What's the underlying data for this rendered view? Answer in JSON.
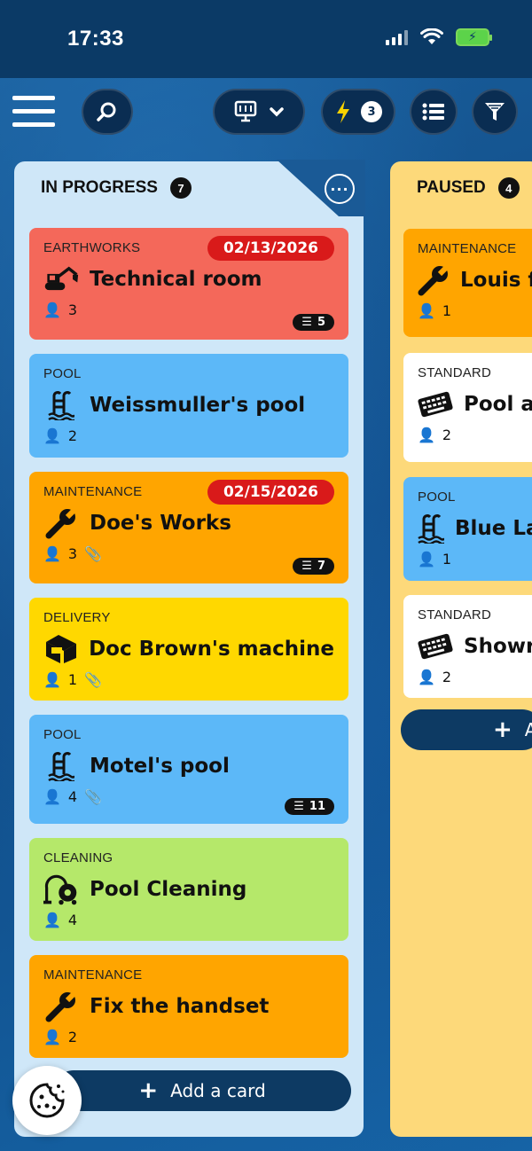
{
  "status_bar": {
    "time": "17:33"
  },
  "toolbar": {
    "quick_count": "3"
  },
  "columns": [
    {
      "title": "IN PROGRESS",
      "count": "7",
      "add_label": "Add a card",
      "cards": [
        {
          "type": "EARTHWORKS",
          "title": "Technical room",
          "members": "3",
          "date": "02/13/2026",
          "checklist": "5",
          "color": "#f4685a",
          "icon": "excavator-icon"
        },
        {
          "type": "POOL",
          "title": "Weissmuller's pool",
          "members": "2",
          "color": "#5cb8f8",
          "icon": "pool-ladder-icon"
        },
        {
          "type": "MAINTENANCE",
          "title": "Doe's Works",
          "members": "3",
          "date": "02/15/2026",
          "checklist": "7",
          "attachment": true,
          "color": "#ffa500",
          "icon": "wrench-icon"
        },
        {
          "type": "DELIVERY",
          "title": "Doc Brown's machine",
          "members": "1",
          "attachment": true,
          "color": "#ffd800",
          "icon": "delivery-box-icon"
        },
        {
          "type": "POOL",
          "title": "Motel's pool",
          "members": "4",
          "checklist": "11",
          "attachment": true,
          "color": "#5cb8f8",
          "icon": "pool-ladder-icon"
        },
        {
          "type": "CLEANING",
          "title": "Pool Cleaning",
          "members": "4",
          "color": "#b5e86a",
          "icon": "vacuum-icon"
        },
        {
          "type": "MAINTENANCE",
          "title": "Fix the handset",
          "members": "2",
          "color": "#ffa500",
          "icon": "wrench-icon"
        }
      ]
    },
    {
      "title": "PAUSED",
      "count": "4",
      "add_label": "A",
      "cards": [
        {
          "type": "MAINTENANCE",
          "title": "Louis f",
          "members": "1",
          "color": "#ffa500",
          "icon": "wrench-icon"
        },
        {
          "type": "STANDARD",
          "title": "Pool a",
          "members": "2",
          "color": "#ffffff",
          "icon": "keyboard-icon"
        },
        {
          "type": "POOL",
          "title": "Blue La",
          "members": "1",
          "color": "#5cb8f8",
          "icon": "pool-ladder-icon"
        },
        {
          "type": "STANDARD",
          "title": "Showr",
          "members": "2",
          "color": "#ffffff",
          "icon": "keyboard-icon"
        }
      ]
    }
  ]
}
